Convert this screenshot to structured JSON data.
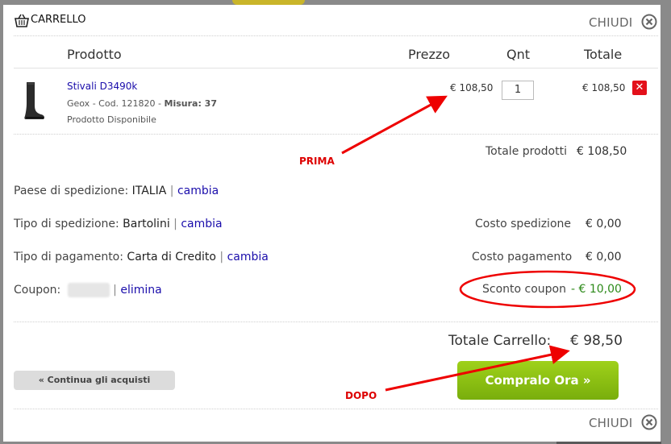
{
  "header": {
    "title": "CARRELLO",
    "close_label": "CHIUDI"
  },
  "columns": {
    "product": "Prodotto",
    "price": "Prezzo",
    "qty": "Qnt",
    "total": "Totale"
  },
  "item": {
    "name": "Stivali D3490k",
    "details_prefix": "Geox - Cod. 121820 - ",
    "size_label": "Misura: 37",
    "availability": "Prodotto Disponibile",
    "price": "€ 108,50",
    "qty": "1",
    "total": "€ 108,50"
  },
  "summary": {
    "products_total_label": "Totale prodotti",
    "products_total_value": "€ 108,50",
    "country_label": "Paese di spedizione:",
    "country_value": "ITALIA",
    "change_link": "cambia",
    "shipping_type_label": "Tipo di spedizione:",
    "shipping_type_value": "Bartolini",
    "payment_type_label": "Tipo di pagamento:",
    "payment_type_value": "Carta di Credito",
    "coupon_label": "Coupon:",
    "remove_link": "elimina",
    "shipping_cost_label": "Costo spedizione",
    "shipping_cost_value": "€ 0,00",
    "payment_cost_label": "Costo pagamento",
    "payment_cost_value": "€ 0,00",
    "coupon_discount_label": "Sconto coupon",
    "coupon_discount_value": "- € 10,00",
    "cart_total_label": "Totale Carrello:",
    "cart_total_value": "€ 98,50"
  },
  "buttons": {
    "continue": "« Continua gli acquisti",
    "buy": "Compralo Ora »"
  },
  "annotations": {
    "before": "PRIMA",
    "after": "DOPO"
  },
  "colors": {
    "link": "#1a0dab",
    "buy_button": "#8cc312",
    "discount": "#2d8a1a",
    "annotation": "#dd0000",
    "delete": "#e3101a"
  }
}
